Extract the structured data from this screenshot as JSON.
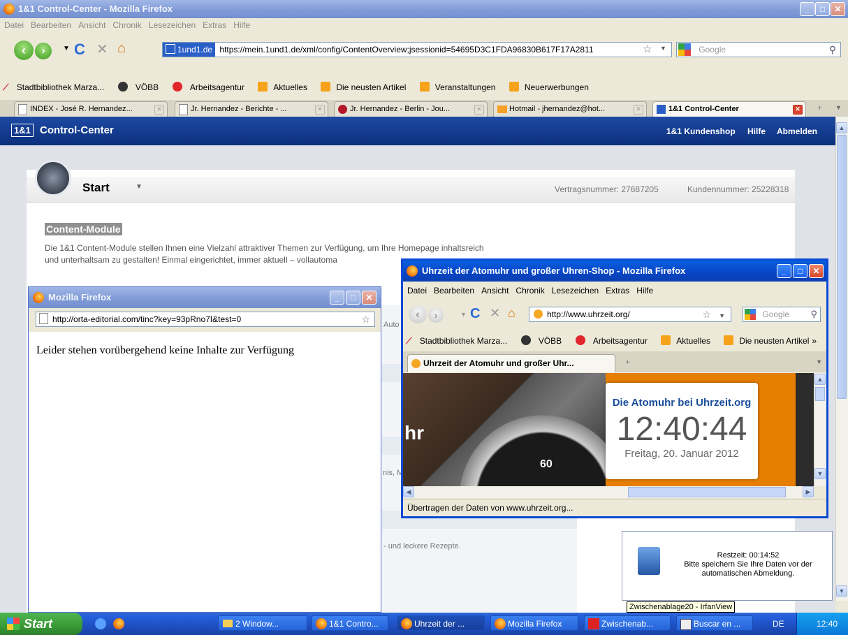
{
  "main_window": {
    "title": "1&1 Control-Center - Mozilla Firefox",
    "menu": [
      "Datei",
      "Bearbeiten",
      "Ansicht",
      "Chronik",
      "Lesezeichen",
      "Extras",
      "Hilfe"
    ],
    "url_site": "1und1.de",
    "url": "https://mein.1und1.de/xml/config/ContentOverview;jsessionid=54695D3C1FDA96830B617F17A2811",
    "search_placeholder": "Google",
    "bookmarks": [
      "Stadtbibliothek Marza...",
      "VÖBB",
      "Arbeitsagentur",
      "Aktuelles",
      "Die neusten Artikel",
      "Veranstaltungen",
      "Neuerwerbungen"
    ],
    "tabs": [
      "INDEX - José R. Hernandez...",
      "Jr. Hernandez - Berichte - ...",
      "Jr. Hernandez - Berlin - Jou...",
      "Hotmail - jhernandez@hot...",
      "1&1 Control-Center"
    ]
  },
  "page": {
    "logo": "1&1",
    "brand": "Control-Center",
    "top_links": [
      "1&1 Kundenshop",
      "Hilfe",
      "Abmelden"
    ],
    "start_label": "Start",
    "contract": "Vertragsnummer: 27687205",
    "customer": "Kundennummer: 25228318",
    "section_title": "Content-Module",
    "intro_line1": "Die 1&1 Content-Module stellen Ihnen eine Vielzahl attraktiver Themen zur Verfügung, um Ihre Homepage inhaltsreich",
    "intro_line2": "und unterhaltsam zu gestalten! Einmal eingerichtet, immer aktuell – vollautoma",
    "frag_auto": "Auto",
    "frag_nis": "nis, M",
    "frag_rezepte": "- und leckere Rezepte."
  },
  "popup_window": {
    "title": "Mozilla Firefox",
    "url": "http://orta-editorial.com/tinc?key=93pRno7I&test=0",
    "message": "Leider stehen vorübergehend keine Inhalte zur Verfügung"
  },
  "clock_window": {
    "title": "Uhrzeit der Atomuhr und großer Uhren-Shop - Mozilla Firefox",
    "menu": [
      "Datei",
      "Bearbeiten",
      "Ansicht",
      "Chronik",
      "Lesezeichen",
      "Extras",
      "Hilfe"
    ],
    "url": "http://www.uhrzeit.org/",
    "search_placeholder": "Google",
    "bookmarks": [
      "Stadtbibliothek Marza...",
      "VÖBB",
      "Arbeitsagentur",
      "Aktuelles",
      "Die neusten Artikel"
    ],
    "bm_more": "»",
    "tab": "Uhrzeit der Atomuhr und großer Uhr...",
    "widget_title": "Die Atomuhr bei Uhrzeit.org",
    "time": "12:40:44",
    "date": "Freitag, 20. Januar 2012",
    "frag_hr": "hr",
    "dial_number": "60",
    "status": "Übertragen der Daten von www.uhrzeit.org..."
  },
  "notification": {
    "line1": "Restzeit:  00:14:52",
    "line2": "Bitte speichern Sie Ihre Daten vor der",
    "line3": "automatischen Abmeldung."
  },
  "tooltip": "Zwischenablage20 - IrfanView",
  "taskbar": {
    "start": "Start",
    "buttons": [
      "2 Window...",
      "1&1 Contro...",
      "Uhrzeit der ...",
      "Mozilla Firefox",
      "Zwischenab...",
      "Buscar en ..."
    ],
    "lang": "DE",
    "clock": "12:40"
  }
}
